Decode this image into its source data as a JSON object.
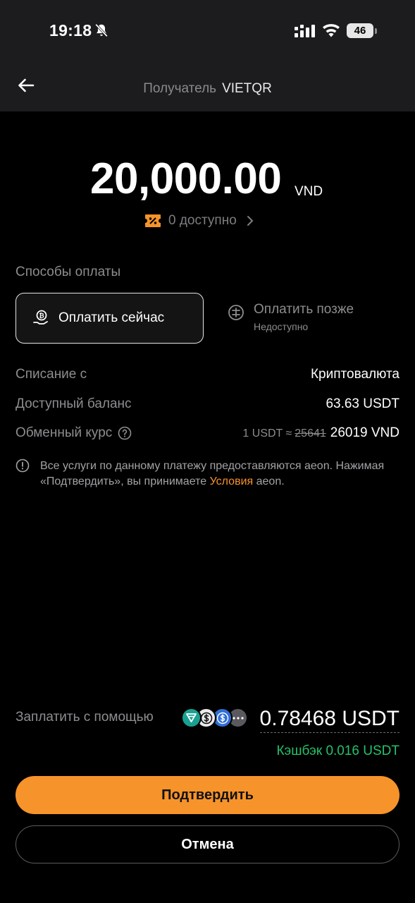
{
  "status_bar": {
    "time": "19:18",
    "battery": "46",
    "icons": [
      "bell-off-icon",
      "signal-icon",
      "wifi-icon",
      "battery-icon"
    ]
  },
  "header": {
    "back_icon": "arrow-left-icon",
    "recipient_label": "Получатель",
    "recipient_value": "VIETQR"
  },
  "amount": {
    "value": "20,000.00",
    "currency": "VND",
    "coupon_icon": "coupon-icon",
    "coupon_text": "0 доступно"
  },
  "payment_methods": {
    "label": "Способы оплаты",
    "pay_now": "Оплатить сейчас",
    "pay_later": "Оплатить позже",
    "pay_later_status": "Недоступно"
  },
  "details": {
    "debit_label": "Списание с",
    "debit_value": "Криптовалюта",
    "balance_label": "Доступный баланс",
    "balance_value": "63.63 USDT",
    "rate_label": "Обменный курс",
    "rate_prefix": "1 USDT ≈",
    "rate_old": "25641",
    "rate_new": "26019 VND"
  },
  "notice": {
    "text_before": "Все услуги по данному платежу предоставляются aeon. Нажимая «Подтвердить», вы принимаете ",
    "link": "Условия",
    "text_after": " aeon."
  },
  "footer": {
    "pay_with_label": "Заплатить с помощью",
    "pay_amount": "0.78468 USDT",
    "cashback": "Кэшбэк 0.016 USDT",
    "confirm_button": "Подтвердить",
    "cancel_button": "Отмена"
  },
  "colors": {
    "accent": "#f6932b",
    "cashback": "#23c26b",
    "background": "#000000",
    "header_bg": "#1c1c1e"
  }
}
